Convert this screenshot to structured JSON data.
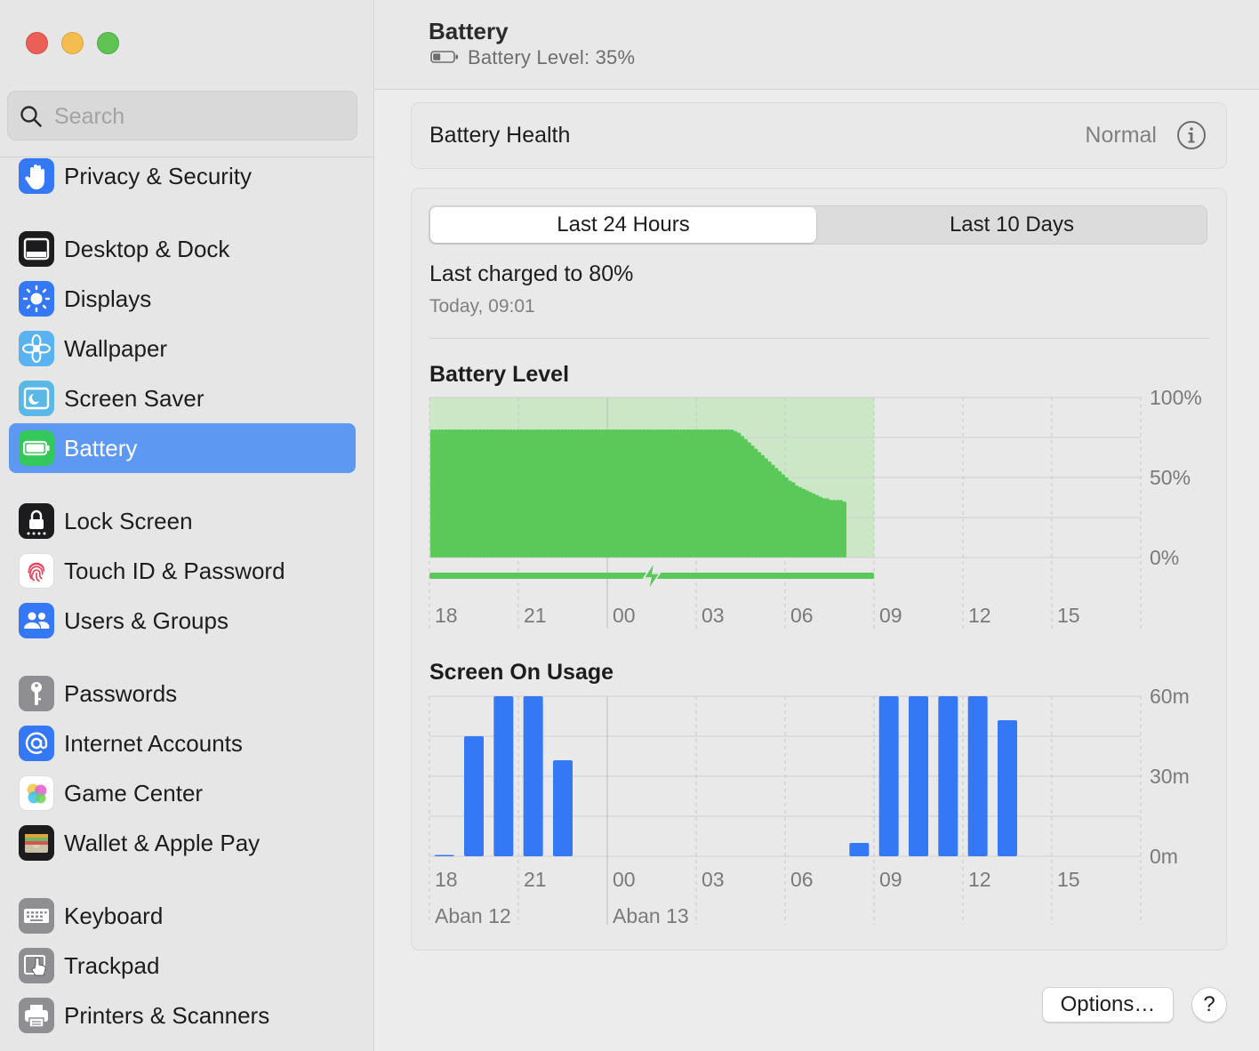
{
  "window": {
    "controls": [
      "close",
      "minimize",
      "zoom"
    ]
  },
  "search": {
    "placeholder": "Search",
    "value": ""
  },
  "sidebar": {
    "items": [
      {
        "label": "Privacy & Security",
        "icon": "hand-icon",
        "color": "#3478f6",
        "active": false
      },
      {
        "label": "Desktop & Dock",
        "icon": "dock-icon",
        "color": "#1c1c1e",
        "active": false
      },
      {
        "label": "Displays",
        "icon": "sun-icon",
        "color": "#3478f6",
        "active": false
      },
      {
        "label": "Wallpaper",
        "icon": "flower-icon",
        "color": "#5ab3f0",
        "active": false
      },
      {
        "label": "Screen Saver",
        "icon": "screen-saver-icon",
        "color": "#5ab8e6",
        "active": false
      },
      {
        "label": "Battery",
        "icon": "battery-icon",
        "color": "#34c759",
        "active": true
      },
      {
        "label": "Lock Screen",
        "icon": "lock-icon",
        "color": "#1c1c1e",
        "active": false
      },
      {
        "label": "Touch ID & Password",
        "icon": "fingerprint-icon",
        "color": "#ffffff",
        "active": false
      },
      {
        "label": "Users & Groups",
        "icon": "users-icon",
        "color": "#3478f6",
        "active": false
      },
      {
        "label": "Passwords",
        "icon": "key-icon",
        "color": "#8e8e93",
        "active": false
      },
      {
        "label": "Internet Accounts",
        "icon": "at-icon",
        "color": "#3478f6",
        "active": false
      },
      {
        "label": "Game Center",
        "icon": "game-center-icon",
        "color": "#ffffff",
        "active": false
      },
      {
        "label": "Wallet & Apple Pay",
        "icon": "wallet-icon",
        "color": "#1c1c1e",
        "active": false
      },
      {
        "label": "Keyboard",
        "icon": "keyboard-icon",
        "color": "#8e8e93",
        "active": false
      },
      {
        "label": "Trackpad",
        "icon": "trackpad-icon",
        "color": "#8e8e93",
        "active": false
      },
      {
        "label": "Printers & Scanners",
        "icon": "printer-icon",
        "color": "#8e8e93",
        "active": false
      }
    ]
  },
  "header": {
    "title": "Battery",
    "subtitle": "Battery Level: 35%"
  },
  "health": {
    "label": "Battery Health",
    "value": "Normal"
  },
  "tabs": [
    {
      "label": "Last 24 Hours",
      "selected": true
    },
    {
      "label": "Last 10 Days",
      "selected": false
    }
  ],
  "last_charged": {
    "title": "Last charged to 80%",
    "time": "Today, 09:01"
  },
  "buttons": {
    "options": "Options…",
    "help": "?"
  },
  "chart_data": [
    {
      "type": "bar",
      "title": "Battery Level",
      "y_ticks": [
        "100%",
        "50%",
        "0%"
      ],
      "ylim": [
        0,
        100
      ],
      "x_ticks": [
        "18",
        "21",
        "00",
        "03",
        "06",
        "09",
        "12",
        "15"
      ],
      "x_range_hours": [
        0,
        24
      ],
      "charging_span_hours": [
        0,
        15
      ],
      "charging_marker_hour": 7.5,
      "color": "#5ac95a",
      "charging_shade_color": "#c5e6c0",
      "values": [
        80,
        80,
        80,
        80,
        80,
        80,
        80,
        80,
        80,
        80,
        80,
        80,
        80,
        80,
        80,
        80,
        80,
        80,
        80,
        80,
        80,
        80,
        80,
        80,
        80,
        80,
        80,
        80,
        80,
        80,
        80,
        80,
        80,
        80,
        80,
        80,
        80,
        80,
        80,
        80,
        80,
        80,
        80,
        80,
        80,
        80,
        80,
        80,
        80,
        80,
        80,
        80,
        80,
        80,
        80,
        80,
        80,
        80,
        80,
        80,
        80,
        80,
        80,
        80,
        80,
        80,
        80,
        80,
        80,
        80,
        80,
        80,
        80,
        80,
        80,
        80,
        80,
        80,
        80,
        80,
        80,
        80,
        80,
        80,
        80,
        80,
        80,
        80,
        80,
        79,
        78,
        76,
        74,
        72,
        70,
        68,
        66,
        64,
        62,
        60,
        58,
        56,
        54,
        52,
        50,
        48,
        47,
        45,
        44,
        43,
        42,
        41,
        40,
        39,
        38,
        37,
        37,
        36,
        36,
        36,
        36,
        35
      ]
    },
    {
      "type": "bar",
      "title": "Screen On Usage",
      "y_ticks": [
        "60m",
        "30m",
        "0m"
      ],
      "ylim": [
        0,
        60
      ],
      "x_ticks": [
        "18",
        "21",
        "00",
        "03",
        "06",
        "09",
        "12",
        "15"
      ],
      "date_labels": [
        {
          "label": "Aban 12",
          "hour": 0
        },
        {
          "label": "Aban 13",
          "hour": 6
        }
      ],
      "color": "#3478f6",
      "hours": [
        0,
        1,
        2,
        3,
        4,
        5,
        6,
        7,
        8,
        9,
        10,
        11,
        12,
        13,
        14,
        15,
        16,
        17,
        18,
        19,
        20,
        21,
        22,
        23
      ],
      "values": [
        0.5,
        45,
        60,
        60,
        36,
        0,
        0,
        0,
        0,
        0,
        0,
        0,
        0,
        0,
        5,
        60,
        60,
        60,
        60,
        51,
        0,
        0,
        0,
        0
      ]
    }
  ]
}
